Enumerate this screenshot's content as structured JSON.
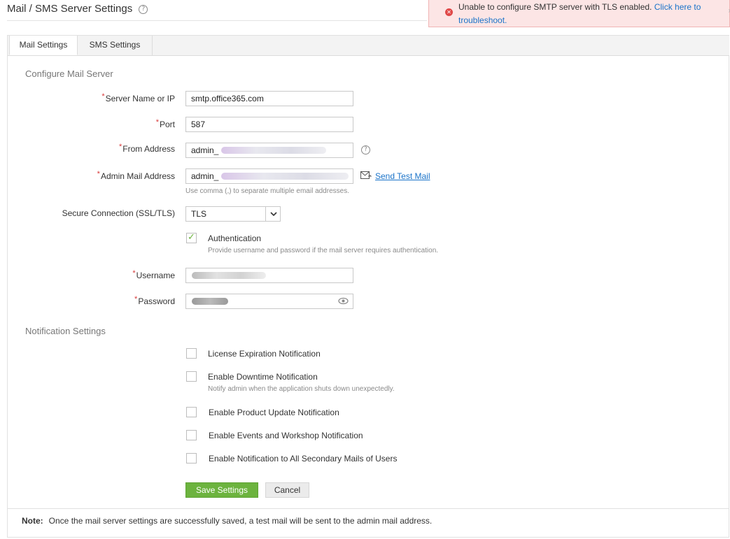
{
  "header": {
    "title": "Mail / SMS Server Settings",
    "help_icon": "question-circle-icon"
  },
  "alert": {
    "message": "Unable to configure SMTP server with TLS enabled.",
    "link_text": "Click here to troubleshoot.",
    "icon": "error-circle-icon",
    "color": "#e04848"
  },
  "tabs": [
    {
      "label": "Mail Settings",
      "active": true
    },
    {
      "label": "SMS Settings",
      "active": false
    }
  ],
  "mail_server": {
    "section_title": "Configure Mail Server",
    "server_label": "Server Name or IP",
    "server_value": "smtp.office365.com",
    "port_label": "Port",
    "port_value": "587",
    "from_label": "From Address",
    "from_value": "admin_",
    "admin_label": "Admin Mail Address",
    "admin_value": "admin_",
    "send_test_mail": "Send Test Mail",
    "admin_hint": "Use comma (,) to separate multiple email addresses.",
    "secure_label": "Secure Connection (SSL/TLS)",
    "secure_value": "TLS",
    "auth_label": "Authentication",
    "auth_checked": true,
    "auth_hint": "Provide username and password if the mail server requires authentication.",
    "username_label": "Username",
    "password_label": "Password"
  },
  "notifications": {
    "section_title": "Notification Settings",
    "items": [
      {
        "label": "License Expiration Notification",
        "checked": false
      },
      {
        "label": "Enable Downtime Notification",
        "checked": false,
        "hint": "Notify admin when the application shuts down unexpectedly."
      },
      {
        "label": "Enable Product Update Notification",
        "checked": false
      },
      {
        "label": "Enable Events and Workshop Notification",
        "checked": false
      },
      {
        "label": "Enable Notification to All Secondary Mails of Users",
        "checked": false
      }
    ]
  },
  "buttons": {
    "save": "Save Settings",
    "cancel": "Cancel"
  },
  "note": {
    "label": "Note:",
    "text": "Once the mail server settings are successfully saved, a test mail will be sent to the admin mail address."
  },
  "colors": {
    "accent_green": "#6cb33e",
    "link_blue": "#1a73c9",
    "required_red": "#d83a3a"
  }
}
